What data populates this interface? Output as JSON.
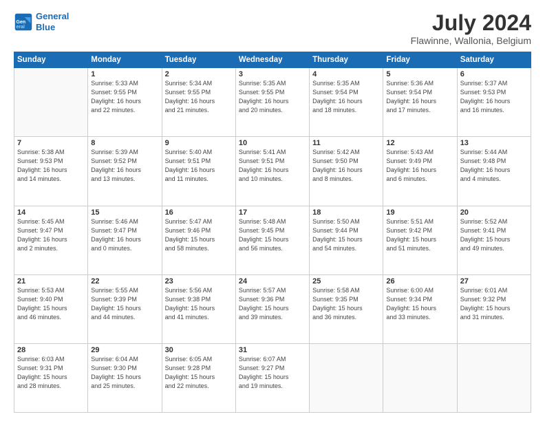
{
  "header": {
    "logo_line1": "General",
    "logo_line2": "Blue",
    "month_year": "July 2024",
    "location": "Flawinne, Wallonia, Belgium"
  },
  "days_of_week": [
    "Sunday",
    "Monday",
    "Tuesday",
    "Wednesday",
    "Thursday",
    "Friday",
    "Saturday"
  ],
  "weeks": [
    [
      {
        "day": "",
        "info": ""
      },
      {
        "day": "1",
        "info": "Sunrise: 5:33 AM\nSunset: 9:55 PM\nDaylight: 16 hours\nand 22 minutes."
      },
      {
        "day": "2",
        "info": "Sunrise: 5:34 AM\nSunset: 9:55 PM\nDaylight: 16 hours\nand 21 minutes."
      },
      {
        "day": "3",
        "info": "Sunrise: 5:35 AM\nSunset: 9:55 PM\nDaylight: 16 hours\nand 20 minutes."
      },
      {
        "day": "4",
        "info": "Sunrise: 5:35 AM\nSunset: 9:54 PM\nDaylight: 16 hours\nand 18 minutes."
      },
      {
        "day": "5",
        "info": "Sunrise: 5:36 AM\nSunset: 9:54 PM\nDaylight: 16 hours\nand 17 minutes."
      },
      {
        "day": "6",
        "info": "Sunrise: 5:37 AM\nSunset: 9:53 PM\nDaylight: 16 hours\nand 16 minutes."
      }
    ],
    [
      {
        "day": "7",
        "info": "Sunrise: 5:38 AM\nSunset: 9:53 PM\nDaylight: 16 hours\nand 14 minutes."
      },
      {
        "day": "8",
        "info": "Sunrise: 5:39 AM\nSunset: 9:52 PM\nDaylight: 16 hours\nand 13 minutes."
      },
      {
        "day": "9",
        "info": "Sunrise: 5:40 AM\nSunset: 9:51 PM\nDaylight: 16 hours\nand 11 minutes."
      },
      {
        "day": "10",
        "info": "Sunrise: 5:41 AM\nSunset: 9:51 PM\nDaylight: 16 hours\nand 10 minutes."
      },
      {
        "day": "11",
        "info": "Sunrise: 5:42 AM\nSunset: 9:50 PM\nDaylight: 16 hours\nand 8 minutes."
      },
      {
        "day": "12",
        "info": "Sunrise: 5:43 AM\nSunset: 9:49 PM\nDaylight: 16 hours\nand 6 minutes."
      },
      {
        "day": "13",
        "info": "Sunrise: 5:44 AM\nSunset: 9:48 PM\nDaylight: 16 hours\nand 4 minutes."
      }
    ],
    [
      {
        "day": "14",
        "info": "Sunrise: 5:45 AM\nSunset: 9:47 PM\nDaylight: 16 hours\nand 2 minutes."
      },
      {
        "day": "15",
        "info": "Sunrise: 5:46 AM\nSunset: 9:47 PM\nDaylight: 16 hours\nand 0 minutes."
      },
      {
        "day": "16",
        "info": "Sunrise: 5:47 AM\nSunset: 9:46 PM\nDaylight: 15 hours\nand 58 minutes."
      },
      {
        "day": "17",
        "info": "Sunrise: 5:48 AM\nSunset: 9:45 PM\nDaylight: 15 hours\nand 56 minutes."
      },
      {
        "day": "18",
        "info": "Sunrise: 5:50 AM\nSunset: 9:44 PM\nDaylight: 15 hours\nand 54 minutes."
      },
      {
        "day": "19",
        "info": "Sunrise: 5:51 AM\nSunset: 9:42 PM\nDaylight: 15 hours\nand 51 minutes."
      },
      {
        "day": "20",
        "info": "Sunrise: 5:52 AM\nSunset: 9:41 PM\nDaylight: 15 hours\nand 49 minutes."
      }
    ],
    [
      {
        "day": "21",
        "info": "Sunrise: 5:53 AM\nSunset: 9:40 PM\nDaylight: 15 hours\nand 46 minutes."
      },
      {
        "day": "22",
        "info": "Sunrise: 5:55 AM\nSunset: 9:39 PM\nDaylight: 15 hours\nand 44 minutes."
      },
      {
        "day": "23",
        "info": "Sunrise: 5:56 AM\nSunset: 9:38 PM\nDaylight: 15 hours\nand 41 minutes."
      },
      {
        "day": "24",
        "info": "Sunrise: 5:57 AM\nSunset: 9:36 PM\nDaylight: 15 hours\nand 39 minutes."
      },
      {
        "day": "25",
        "info": "Sunrise: 5:58 AM\nSunset: 9:35 PM\nDaylight: 15 hours\nand 36 minutes."
      },
      {
        "day": "26",
        "info": "Sunrise: 6:00 AM\nSunset: 9:34 PM\nDaylight: 15 hours\nand 33 minutes."
      },
      {
        "day": "27",
        "info": "Sunrise: 6:01 AM\nSunset: 9:32 PM\nDaylight: 15 hours\nand 31 minutes."
      }
    ],
    [
      {
        "day": "28",
        "info": "Sunrise: 6:03 AM\nSunset: 9:31 PM\nDaylight: 15 hours\nand 28 minutes."
      },
      {
        "day": "29",
        "info": "Sunrise: 6:04 AM\nSunset: 9:30 PM\nDaylight: 15 hours\nand 25 minutes."
      },
      {
        "day": "30",
        "info": "Sunrise: 6:05 AM\nSunset: 9:28 PM\nDaylight: 15 hours\nand 22 minutes."
      },
      {
        "day": "31",
        "info": "Sunrise: 6:07 AM\nSunset: 9:27 PM\nDaylight: 15 hours\nand 19 minutes."
      },
      {
        "day": "",
        "info": ""
      },
      {
        "day": "",
        "info": ""
      },
      {
        "day": "",
        "info": ""
      }
    ]
  ]
}
